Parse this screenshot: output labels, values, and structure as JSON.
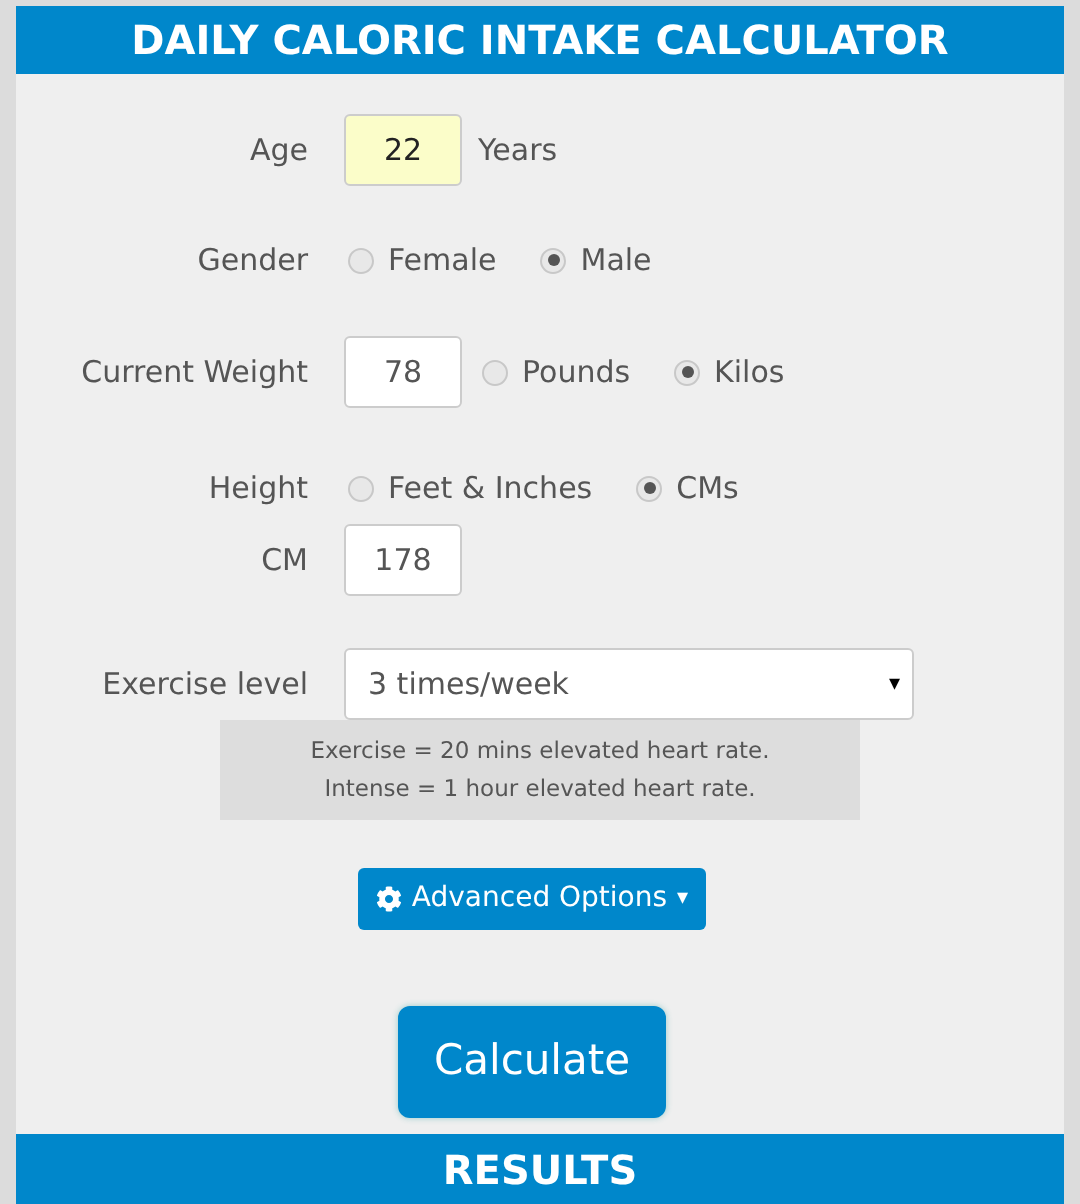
{
  "header": {
    "title": "DAILY CALORIC INTAKE CALCULATOR"
  },
  "rows": [
    {
      "kind": "input",
      "label": "Age",
      "value": "22",
      "highlighted": true,
      "suffix": "Years"
    },
    {
      "kind": "radios",
      "label": "Gender",
      "options": [
        {
          "label": "Female",
          "selected": false
        },
        {
          "label": "Male",
          "selected": true
        }
      ]
    },
    {
      "kind": "input-radios",
      "label": "Current Weight",
      "value": "78",
      "highlighted": false,
      "options": [
        {
          "label": "Pounds",
          "selected": false
        },
        {
          "label": "Kilos",
          "selected": true
        }
      ]
    },
    {
      "kind": "radios",
      "label": "Height",
      "options": [
        {
          "label": "Feet & Inches",
          "selected": false
        },
        {
          "label": "CMs",
          "selected": true
        }
      ]
    },
    {
      "kind": "input",
      "label": "CM",
      "value": "178",
      "highlighted": false
    }
  ],
  "exercise": {
    "label": "Exercise level",
    "value": "3 times/week",
    "arrow": "▾",
    "note": [
      "Exercise = 20 mins elevated heart rate.",
      "Intense = 1 hour elevated heart rate."
    ]
  },
  "advanced_button": {
    "label": "Advanced Options",
    "arrow": "▾"
  },
  "calculate_button": {
    "label": "Calculate"
  },
  "results": {
    "title": "RESULTS"
  }
}
